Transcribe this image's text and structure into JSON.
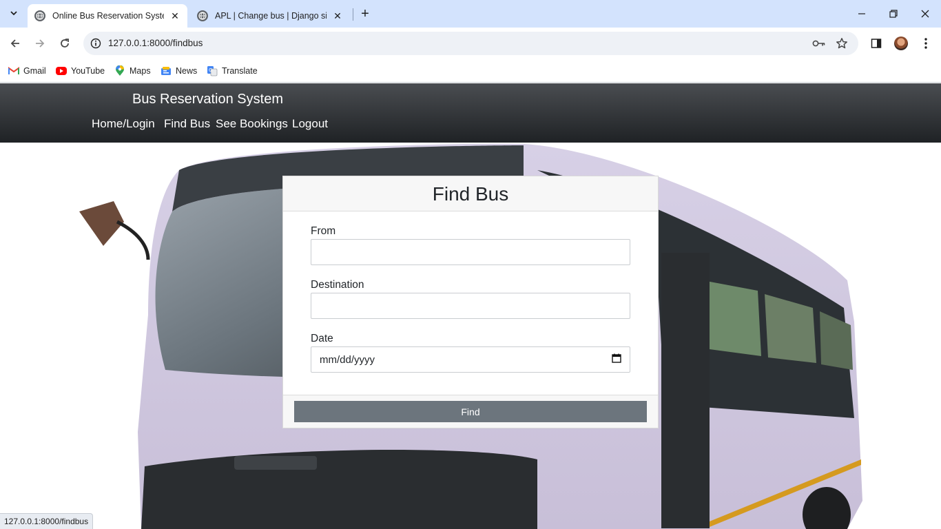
{
  "browser": {
    "tabs": [
      {
        "title": "Online Bus Reservation System",
        "active": true
      },
      {
        "title": "APL | Change bus | Django site",
        "active": false
      }
    ],
    "url": "127.0.0.1:8000/findbus",
    "bookmarks": [
      {
        "label": "Gmail",
        "icon": "gmail-icon"
      },
      {
        "label": "YouTube",
        "icon": "youtube-icon"
      },
      {
        "label": "Maps",
        "icon": "maps-icon"
      },
      {
        "label": "News",
        "icon": "news-icon"
      },
      {
        "label": "Translate",
        "icon": "translate-icon"
      }
    ],
    "status_url": "127.0.0.1:8000/findbus"
  },
  "site": {
    "brand": "Bus Reservation System",
    "nav": [
      "Home/Login",
      "Find Bus",
      "See Bookings",
      "Logout"
    ]
  },
  "form": {
    "title": "Find Bus",
    "from_label": "From",
    "from_value": "",
    "destination_label": "Destination",
    "destination_value": "",
    "date_label": "Date",
    "date_placeholder": "mm/dd/yyyy",
    "submit_label": "Find"
  },
  "colors": {
    "navbar": "#1f2225",
    "button": "#6c757d",
    "tabstrip": "#d3e3fd"
  }
}
